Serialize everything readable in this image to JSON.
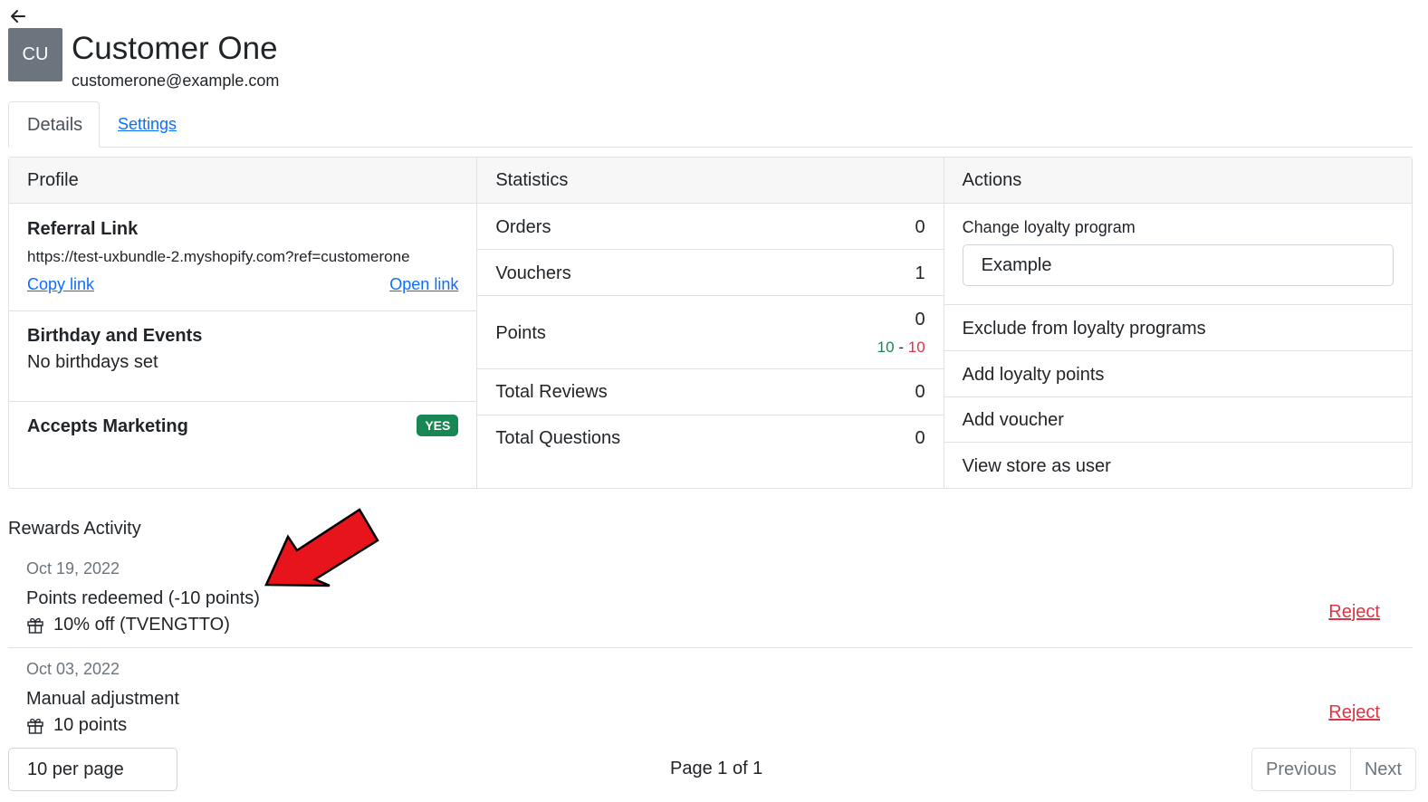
{
  "header": {
    "avatar_initials": "CU",
    "name": "Customer One",
    "email": "customerone@example.com"
  },
  "tabs": [
    {
      "label": "Details",
      "active": true
    },
    {
      "label": "Settings",
      "active": false
    }
  ],
  "profile": {
    "title": "Profile",
    "referral": {
      "title": "Referral Link",
      "url": "https://test-uxbundle-2.myshopify.com?ref=customerone",
      "copy_label": "Copy link",
      "open_label": "Open link"
    },
    "birthday": {
      "title": "Birthday and Events",
      "text": "No birthdays set"
    },
    "marketing": {
      "title": "Accepts Marketing",
      "badge": "YES"
    }
  },
  "statistics": {
    "title": "Statistics",
    "rows": [
      {
        "label": "Orders",
        "value": "0"
      },
      {
        "label": "Vouchers",
        "value": "1"
      },
      {
        "label": "Points",
        "value": "0",
        "earned": "10",
        "sep": "-",
        "spent": "10"
      },
      {
        "label": "Total Reviews",
        "value": "0"
      },
      {
        "label": "Total Questions",
        "value": "0"
      }
    ]
  },
  "actions": {
    "title": "Actions",
    "program_label": "Change loyalty program",
    "program_value": "Example",
    "items": [
      "Exclude from loyalty programs",
      "Add loyalty points",
      "Add voucher",
      "View store as user"
    ]
  },
  "rewards": {
    "title": "Rewards Activity",
    "items": [
      {
        "date": "Oct 19, 2022",
        "title": "Points redeemed (-10 points)",
        "detail": "10% off (TVENGTTO)",
        "action": "Reject"
      },
      {
        "date": "Oct 03, 2022",
        "title": "Manual adjustment",
        "detail": "10 points",
        "action": "Reject"
      }
    ]
  },
  "pagination": {
    "per_page": "10 per page",
    "page_info": "Page 1 of 1",
    "previous": "Previous",
    "next": "Next"
  },
  "colors": {
    "primary": "#0d6efd",
    "success": "#198754",
    "danger": "#dc3545",
    "annotation_arrow": "#e8141c"
  }
}
